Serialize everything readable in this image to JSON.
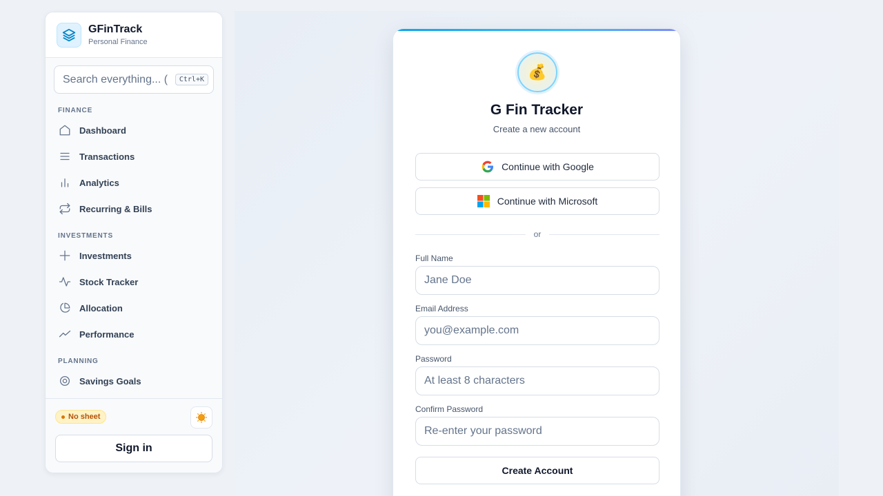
{
  "sidebar": {
    "brand": {
      "title": "GFinTrack",
      "subtitle": "Personal Finance"
    },
    "search": {
      "placeholder": "Search everything... (",
      "shortcut": "Ctrl+K"
    },
    "sections": [
      {
        "label": "FINANCE",
        "items": [
          {
            "label": "Dashboard",
            "icon": "home-icon"
          },
          {
            "label": "Transactions",
            "icon": "list-icon"
          },
          {
            "label": "Analytics",
            "icon": "bar-chart-icon"
          },
          {
            "label": "Recurring & Bills",
            "icon": "repeat-icon"
          }
        ]
      },
      {
        "label": "INVESTMENTS",
        "items": [
          {
            "label": "Investments",
            "icon": "plus-icon"
          },
          {
            "label": "Stock Tracker",
            "icon": "activity-icon"
          },
          {
            "label": "Allocation",
            "icon": "pie-chart-icon"
          },
          {
            "label": "Performance",
            "icon": "trending-icon"
          }
        ]
      },
      {
        "label": "PLANNING",
        "items": [
          {
            "label": "Savings Goals",
            "icon": "target-icon"
          }
        ]
      }
    ],
    "footer": {
      "status_badge": "No sheet",
      "sign_in_label": "Sign in"
    }
  },
  "signup": {
    "logo_emoji": "💰",
    "title": "G Fin Tracker",
    "subtitle": "Create a new account",
    "google_label": "Continue with Google",
    "microsoft_label": "Continue with Microsoft",
    "divider_text": "or",
    "fields": [
      {
        "label": "Full Name",
        "placeholder": "Jane Doe"
      },
      {
        "label": "Email Address",
        "placeholder": "you@example.com"
      },
      {
        "label": "Password",
        "placeholder": "At least 8 characters"
      },
      {
        "label": "Confirm Password",
        "placeholder": "Re-enter your password"
      }
    ],
    "submit_label": "Create Account"
  },
  "colors": {
    "accent": "#0ea5e9",
    "badge_bg": "#fef3c7",
    "badge_text": "#b45309"
  }
}
